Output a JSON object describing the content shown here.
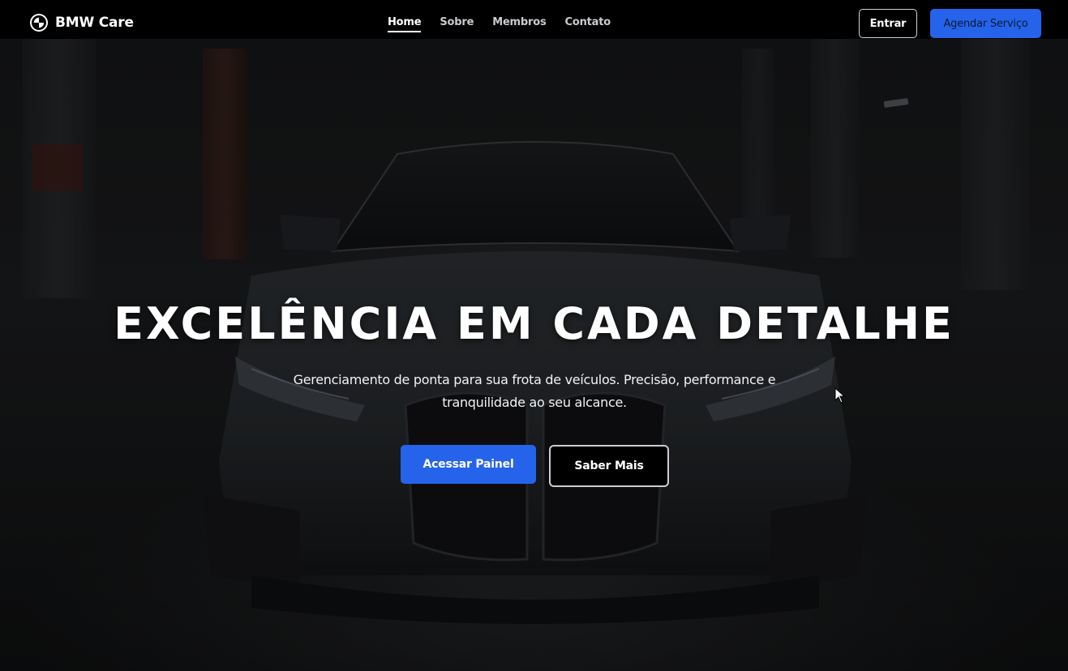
{
  "navbar": {
    "brand": "BMW Care",
    "links": [
      {
        "label": "Home",
        "active": true
      },
      {
        "label": "Sobre",
        "active": false
      },
      {
        "label": "Membros",
        "active": false
      },
      {
        "label": "Contato",
        "active": false
      }
    ],
    "login_label": "Entrar",
    "schedule_label": "Agendar Serviço"
  },
  "hero": {
    "title": "EXCELÊNCIA EM CADA DETALHE",
    "subtitle": "Gerenciamento de ponta para sua frota de veículos. Precisão, performance e tranquilidade ao seu alcance.",
    "primary_cta": "Acessar Painel",
    "secondary_cta": "Saber Mais"
  },
  "colors": {
    "accent": "#2563eb",
    "navbar_bg": "#000000"
  },
  "icons": {
    "brand": "bmw-roundel-icon",
    "cursor": "mouse-pointer-icon"
  }
}
